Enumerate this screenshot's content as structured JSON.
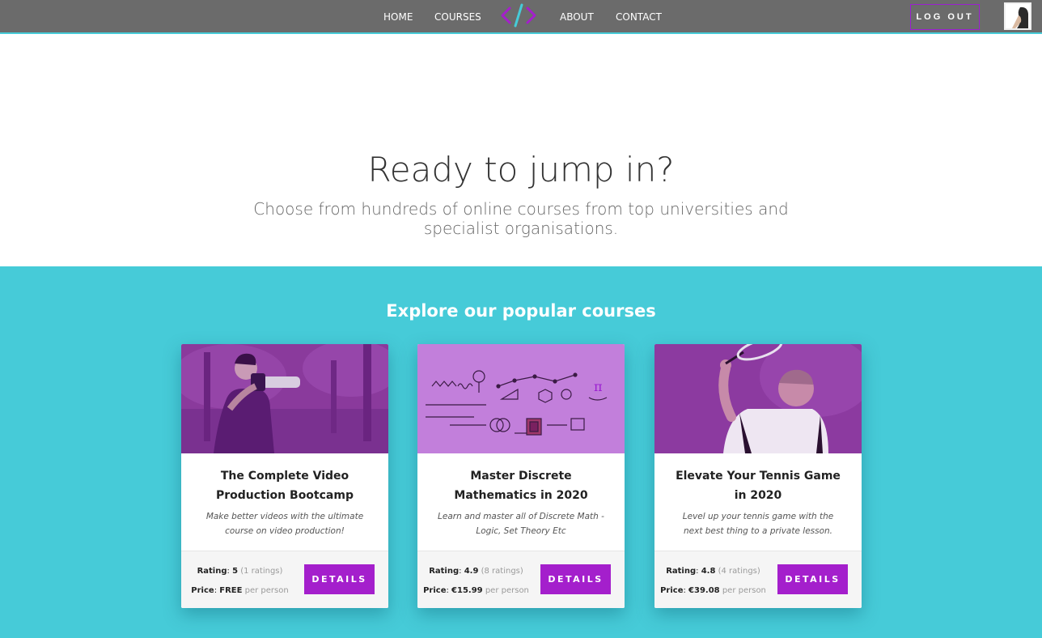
{
  "nav": {
    "links": [
      "HOME",
      "COURSES",
      "ABOUT",
      "CONTACT"
    ],
    "logout_label": "LOG OUT"
  },
  "hero": {
    "title": "Ready to jump in?",
    "subtitle": "Choose from hundreds of online courses from top universities and specialist organisations."
  },
  "section": {
    "title": "Explore our popular courses"
  },
  "labels": {
    "rating": "Rating",
    "price": "Price",
    "per_person": "per person",
    "details": "DETAILS"
  },
  "courses": [
    {
      "title": "The Complete Video Production Bootcamp",
      "description": "Make better videos with the ultimate course on video production!",
      "rating": "5",
      "ratings_count": "(1 ratings)",
      "price": "FREE"
    },
    {
      "title": "Master Discrete Mathematics in 2020",
      "description": "Learn and master all of Discrete Math - Logic, Set Theory Etc",
      "rating": "4.9",
      "ratings_count": "(8 ratings)",
      "price": "€15.99"
    },
    {
      "title": "Elevate Your Tennis Game in 2020",
      "description": "Level up your tennis game with the next best thing to a private lesson.",
      "rating": "4.8",
      "ratings_count": "(4 ratings)",
      "price": "€39.08"
    }
  ],
  "colors": {
    "navbar": "#6b6b6b",
    "accent_teal": "#46cbd8",
    "accent_purple": "#a41fcc"
  }
}
